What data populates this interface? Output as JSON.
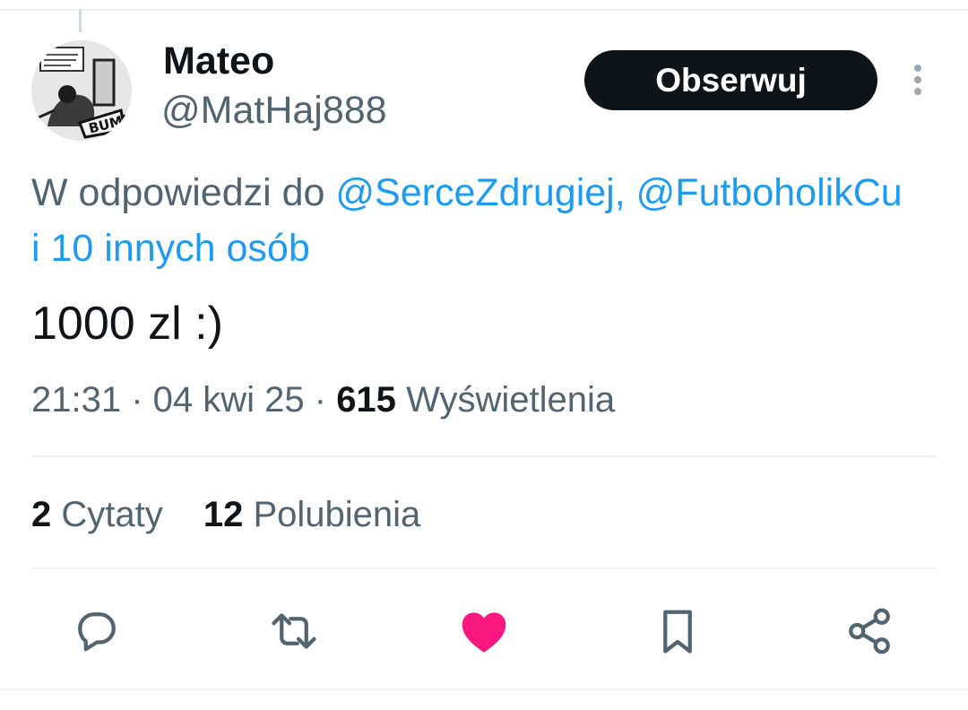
{
  "author": {
    "display_name": "Mateo",
    "handle": "@MatHaj888",
    "avatar_icon": "comic-avatar"
  },
  "follow_label": "Obserwuj",
  "more_icon": "more-vertical-icon",
  "reply_context": {
    "prefix": "W odpowiedzi do ",
    "mention_1": "@SerceZdrugiej",
    "separator": ", ",
    "mention_2": "@FutboholikCu",
    "others": "i 10 innych osób"
  },
  "tweet_text": "1000 zl :)",
  "meta": {
    "time": "21:31",
    "dot": " · ",
    "date": "04 kwi 25",
    "views_count": "615",
    "views_label": "Wyświetlenia"
  },
  "stats": {
    "quotes_count": "2",
    "quotes_label": "Cytaty",
    "likes_count": "12",
    "likes_label": "Polubienia"
  },
  "actions": [
    "reply-icon",
    "retweet-icon",
    "heart-filled-icon",
    "bookmark-icon",
    "share-icon"
  ],
  "colors": {
    "link": "#1d9bf0",
    "secondary_text": "#536471",
    "like_active": "#f91880",
    "follow_button_bg": "#0f1419"
  }
}
